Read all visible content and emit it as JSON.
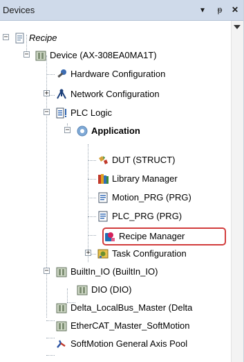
{
  "panel": {
    "title": "Devices",
    "buttons": {
      "dropdown": "▾",
      "pin": "ᵽ",
      "close": "✕"
    }
  },
  "tree": {
    "root_label": "Recipe",
    "device_label": "Device (AX-308EA0MA1T)",
    "hardware_label": "Hardware Configuration",
    "network_label": "Network Configuration",
    "plc_logic_label": "PLC Logic",
    "application_label": "Application",
    "dut_label": "DUT (STRUCT)",
    "library_label": "Library Manager",
    "motion_label": "Motion_PRG (PRG)",
    "plcprg_label": "PLC_PRG (PRG)",
    "recipe_label": "Recipe Manager",
    "task_label": "Task Configuration",
    "builtin_label": "BuiltIn_IO (BuiltIn_IO)",
    "dio_label": "DIO (DIO)",
    "localbus_label": "Delta_LocalBus_Master (Delta",
    "ethercat_label": "EtherCAT_Master_SoftMotion",
    "softmotion_label": "SoftMotion General Axis Pool"
  },
  "expanders": {
    "minus": "−",
    "plus": "+"
  }
}
